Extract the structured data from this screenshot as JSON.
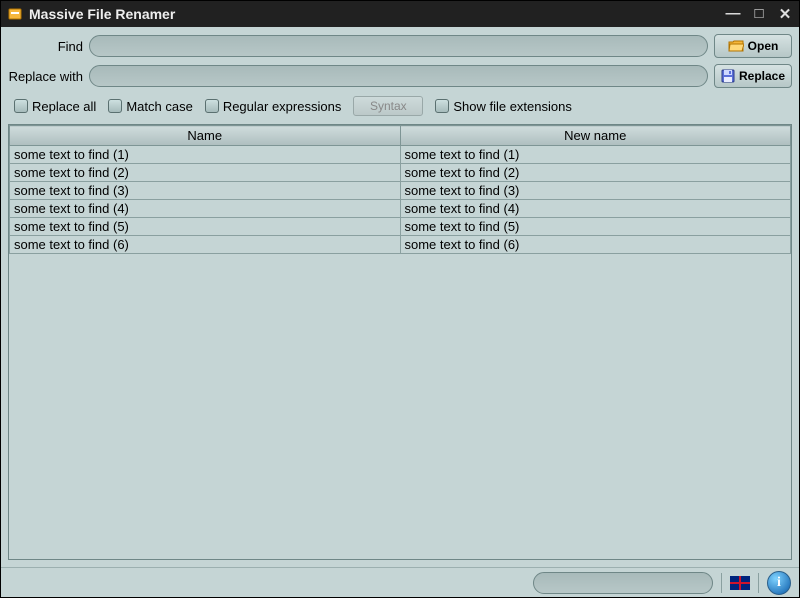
{
  "window": {
    "title": "Massive File Renamer",
    "controls": {
      "min": "—",
      "max": "□",
      "close": "✕"
    }
  },
  "form": {
    "find_label": "Find",
    "find_value": "",
    "replace_label": "Replace with",
    "replace_value": ""
  },
  "buttons": {
    "open": "Open",
    "replace": "Replace"
  },
  "options": {
    "replace_all": "Replace all",
    "match_case": "Match case",
    "regex": "Regular expressions",
    "syntax": "Syntax",
    "show_ext": "Show file extensions"
  },
  "table": {
    "headers": {
      "name": "Name",
      "new_name": "New name"
    },
    "rows": [
      {
        "name": "some text to find (1)",
        "new_name": "some text to find (1)"
      },
      {
        "name": "some text to find (2)",
        "new_name": "some text to find (2)"
      },
      {
        "name": "some text to find (3)",
        "new_name": "some text to find (3)"
      },
      {
        "name": "some text to find (4)",
        "new_name": "some text to find (4)"
      },
      {
        "name": "some text to find (5)",
        "new_name": "some text to find (5)"
      },
      {
        "name": "some text to find (6)",
        "new_name": "some text to find (6)"
      }
    ]
  },
  "statusbar": {
    "info": "i"
  },
  "icons": {
    "folder_color": "#f6b73c",
    "floppy_color": "#5a6fd8"
  }
}
